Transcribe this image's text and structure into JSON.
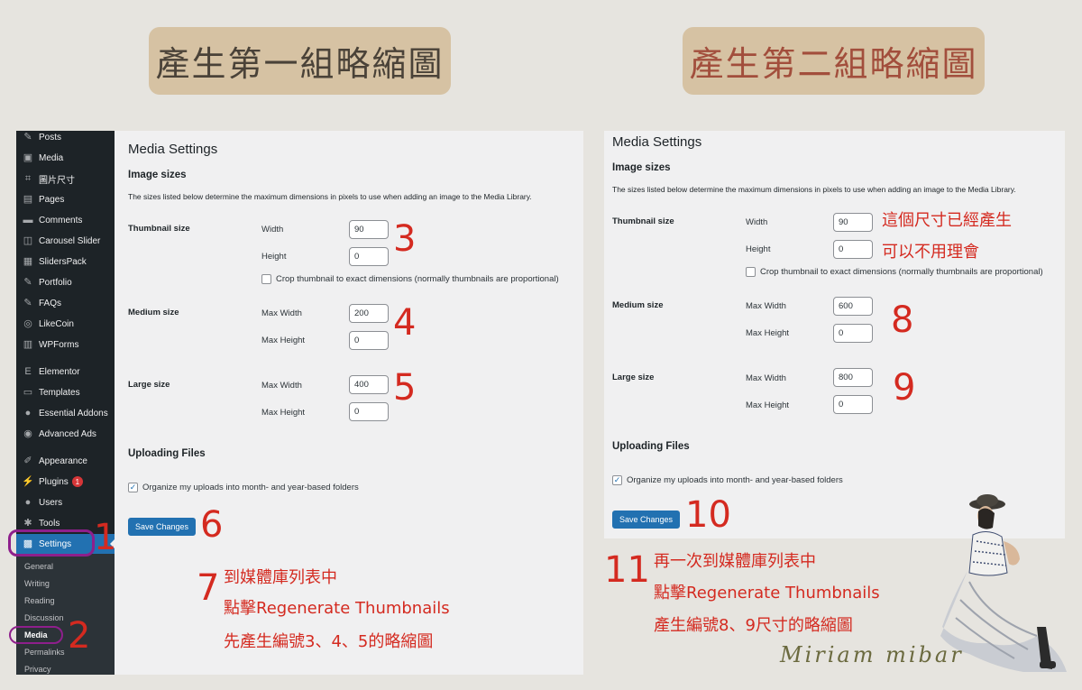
{
  "banners": {
    "left": "產生第一組略縮圖",
    "right": "產生第二組略縮圖"
  },
  "sidebar": {
    "items": [
      {
        "label": "Posts",
        "icon": "pin-icon"
      },
      {
        "label": "Media",
        "icon": "media-icon"
      },
      {
        "label": "圖片尺寸",
        "icon": "crop-icon"
      },
      {
        "label": "Pages",
        "icon": "pages-icon"
      },
      {
        "label": "Comments",
        "icon": "comments-icon"
      },
      {
        "label": "Carousel Slider",
        "icon": "carousel-icon"
      },
      {
        "label": "SlidersPack",
        "icon": "sliderspack-icon"
      },
      {
        "label": "Portfolio",
        "icon": "pin-icon"
      },
      {
        "label": "FAQs",
        "icon": "pin-icon"
      },
      {
        "label": "LikeCoin",
        "icon": "likecoin-icon"
      },
      {
        "label": "WPForms",
        "icon": "wpforms-icon"
      },
      {
        "label": "Elementor",
        "icon": "elementor-icon"
      },
      {
        "label": "Templates",
        "icon": "folder-icon"
      },
      {
        "label": "Essential Addons",
        "icon": "ea-icon"
      },
      {
        "label": "Advanced Ads",
        "icon": "ads-icon"
      },
      {
        "label": "Appearance",
        "icon": "brush-icon"
      },
      {
        "label": "Plugins",
        "icon": "plugin-icon",
        "badge": "1"
      },
      {
        "label": "Users",
        "icon": "user-icon"
      },
      {
        "label": "Tools",
        "icon": "wrench-icon"
      },
      {
        "label": "Settings",
        "icon": "settings-icon",
        "active": true
      }
    ],
    "submenu": [
      "General",
      "Writing",
      "Reading",
      "Discussion",
      "Media",
      "Permalinks",
      "Privacy"
    ]
  },
  "left_panel": {
    "title": "Media Settings",
    "image_sizes_heading": "Image sizes",
    "description": "The sizes listed below determine the maximum dimensions in pixels to use when adding an image to the Media Library.",
    "thumbnail": {
      "label": "Thumbnail size",
      "width_label": "Width",
      "width": "90",
      "height_label": "Height",
      "height": "0"
    },
    "crop_label": "Crop thumbnail to exact dimensions (normally thumbnails are proportional)",
    "medium": {
      "label": "Medium size",
      "width_label": "Max Width",
      "width": "200",
      "height_label": "Max Height",
      "height": "0"
    },
    "large": {
      "label": "Large size",
      "width_label": "Max Width",
      "width": "400",
      "height_label": "Max Height",
      "height": "0"
    },
    "uploading_heading": "Uploading Files",
    "organize_label": "Organize my uploads into month- and year-based folders",
    "save_button": "Save Changes"
  },
  "right_panel": {
    "title": "Media Settings",
    "image_sizes_heading": "Image sizes",
    "description": "The sizes listed below determine the maximum dimensions in pixels to use when adding an image to the Media Library.",
    "thumbnail": {
      "label": "Thumbnail size",
      "width_label": "Width",
      "width": "90",
      "height_label": "Height",
      "height": "0"
    },
    "crop_label": "Crop thumbnail to exact dimensions (normally thumbnails are proportional)",
    "medium": {
      "label": "Medium size",
      "width_label": "Max Width",
      "width": "600",
      "height_label": "Max Height",
      "height": "0"
    },
    "large": {
      "label": "Large size",
      "width_label": "Max Width",
      "width": "800",
      "height_label": "Max Height",
      "height": "0"
    },
    "uploading_heading": "Uploading Files",
    "organize_label": "Organize my uploads into month- and year-based folders",
    "save_button": "Save Changes"
  },
  "annotations": {
    "n1": "1",
    "n2": "2",
    "n3": "3",
    "n4": "4",
    "n5": "5",
    "n6": "6",
    "n7": "7",
    "n8": "8",
    "n9": "9",
    "n10": "10",
    "n11": "11",
    "note7_line1": "到媒體庫列表中",
    "note7_line2": "點擊Regenerate Thumbnails",
    "note7_line3": "先產生編號3、4、5的略縮圖",
    "note_thumb_line1": "這個尺寸已經產生",
    "note_thumb_line2": "可以不用理會",
    "note11_line1": "再一次到媒體庫列表中",
    "note11_line2": "點擊Regenerate Thumbnails",
    "note11_line3": "產生編號8、9尺寸的略縮圖"
  },
  "signature": "Miriam  mibar",
  "colors": {
    "annotation_red": "#d42a20",
    "highlight_purple": "#8e1f8c",
    "wp_blue": "#2271b1",
    "banner_tan": "#d6c2a3"
  }
}
